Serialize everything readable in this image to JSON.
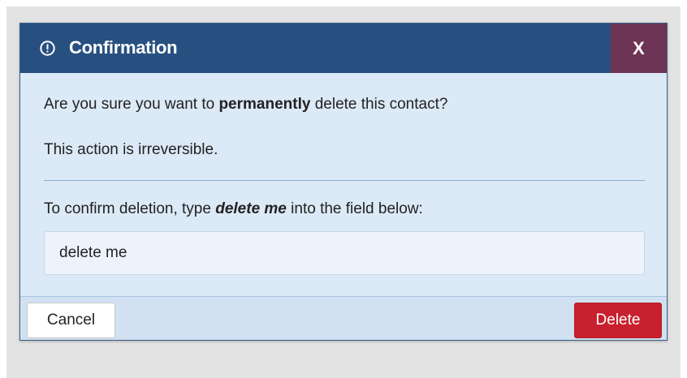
{
  "dialog": {
    "title": "Confirmation",
    "close_label": "X",
    "message": {
      "pre": "Are you sure you want to ",
      "emphasis": "permanently",
      "post": " delete this contact?"
    },
    "warning": "This action is irreversible.",
    "instruction": {
      "pre": "To confirm deletion, type ",
      "emphasis": "delete me",
      "post": " into the field below:"
    },
    "input_value": "delete me",
    "cancel_label": "Cancel",
    "delete_label": "Delete"
  },
  "icons": {
    "title_icon": "exclamation-circle-icon"
  },
  "colors": {
    "titlebar": "#275080",
    "close_button": "#6e3456",
    "dialog_body": "#dce9f7",
    "delete_button": "#c8202e"
  }
}
